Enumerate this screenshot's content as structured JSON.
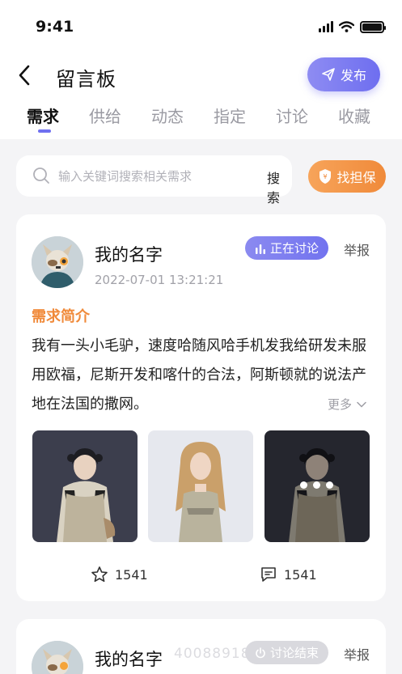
{
  "status_bar": {
    "time": "9:41"
  },
  "header": {
    "title": "留言板",
    "publish_label": "发布"
  },
  "tabs": [
    {
      "label": "需求",
      "active": true
    },
    {
      "label": "供给",
      "active": false
    },
    {
      "label": "动态",
      "active": false
    },
    {
      "label": "指定",
      "active": false
    },
    {
      "label": "讨论",
      "active": false
    },
    {
      "label": "收藏",
      "active": false
    }
  ],
  "search": {
    "placeholder": "输入关键词搜索相关需求",
    "button_label": "搜索",
    "guarantee_label": "找担保"
  },
  "posts": [
    {
      "username": "我的名字",
      "timestamp": "2022-07-01 13:21:21",
      "status": "正在讨论",
      "report_label": "举报",
      "section_title": "需求简介",
      "description": "我有一头小毛驴，速度哈随风哈手机发我给研发未服用欧福，尼斯开发和喀什的合法，阿斯顿就的说法产地在法国的撒网。",
      "more_label": "更多",
      "favorite_count": "1541",
      "comment_count": "1541"
    },
    {
      "username": "我的名字",
      "status": "讨论结束",
      "report_label": "举报",
      "watermark": "4008891800"
    }
  ],
  "colors": {
    "accent": "#6f70f0",
    "orange": "#f08a3a",
    "background": "#f4f4f6"
  }
}
